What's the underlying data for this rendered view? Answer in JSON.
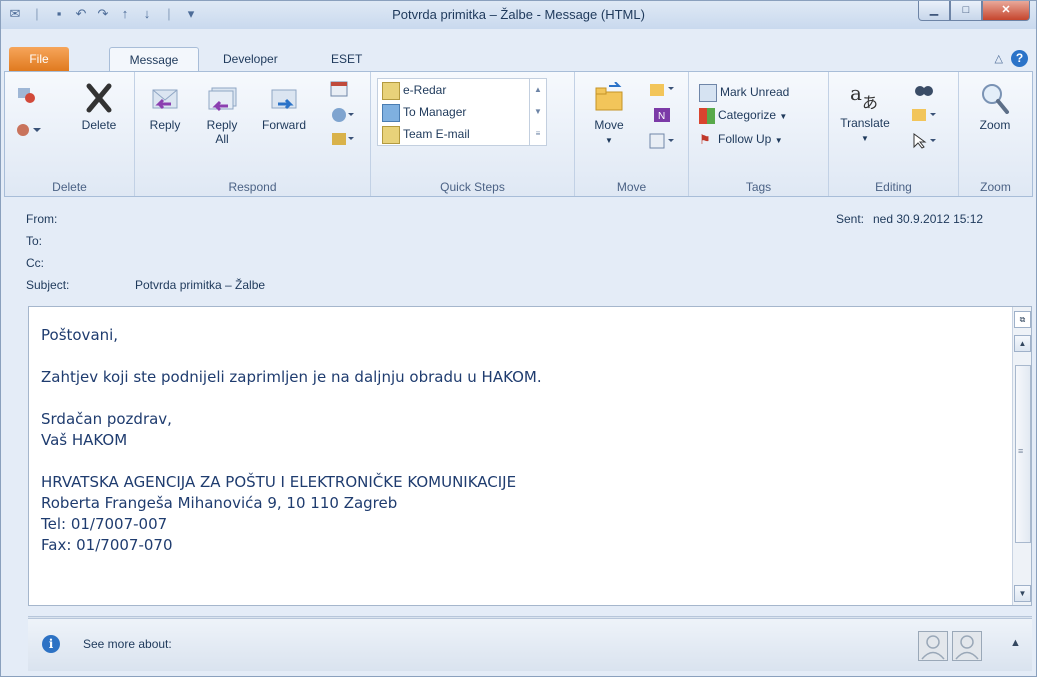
{
  "window": {
    "title": "Potvrda primitka – Žalbe  -  Message (HTML)"
  },
  "tabs": [
    "File",
    "Message",
    "Developer",
    "ESET"
  ],
  "ribbon": {
    "delete_group": {
      "delete_label": "Delete",
      "group_label": "Delete"
    },
    "respond_group": {
      "reply": "Reply",
      "reply_all_1": "Reply",
      "reply_all_2": "All",
      "forward": "Forward",
      "group_label": "Respond"
    },
    "quick_steps": {
      "items": [
        "e-Redar",
        "To Manager",
        "Team E-mail"
      ],
      "group_label": "Quick Steps"
    },
    "move_group": {
      "move": "Move",
      "group_label": "Move"
    },
    "tags_group": {
      "mark_unread": "Mark Unread",
      "categorize": "Categorize",
      "follow_up": "Follow Up",
      "group_label": "Tags"
    },
    "editing_group": {
      "translate": "Translate",
      "group_label": "Editing"
    },
    "zoom_group": {
      "zoom": "Zoom",
      "group_label": "Zoom"
    }
  },
  "header": {
    "from_label": "From:",
    "to_label": "To:",
    "cc_label": "Cc:",
    "subject_label": "Subject:",
    "subject_value": "Potvrda primitka – Žalbe",
    "sent_label": "Sent:",
    "sent_value": "ned 30.9.2012 15:12"
  },
  "body": {
    "greeting": "Poštovani,",
    "line1": "Zahtjev koji ste podnijeli zaprimljen je na daljnju obradu u HAKOM.",
    "closing": "Srdačan pozdrav,",
    "signature": "Vaš HAKOM",
    "org": "HRVATSKA AGENCIJA ZA POŠTU I ELEKTRONIČKE KOMUNIKACIJE",
    "address": "Roberta Frangeša Mihanovića 9, 10 110 Zagreb",
    "tel": "Tel: 01/7007-007",
    "fax": "Fax: 01/7007-070"
  },
  "people_pane": {
    "see_more": "See more about:"
  },
  "colors": {
    "accent": "#2b73c8",
    "file_tab": "#e07a1f",
    "body_text": "#1f3c6f"
  }
}
